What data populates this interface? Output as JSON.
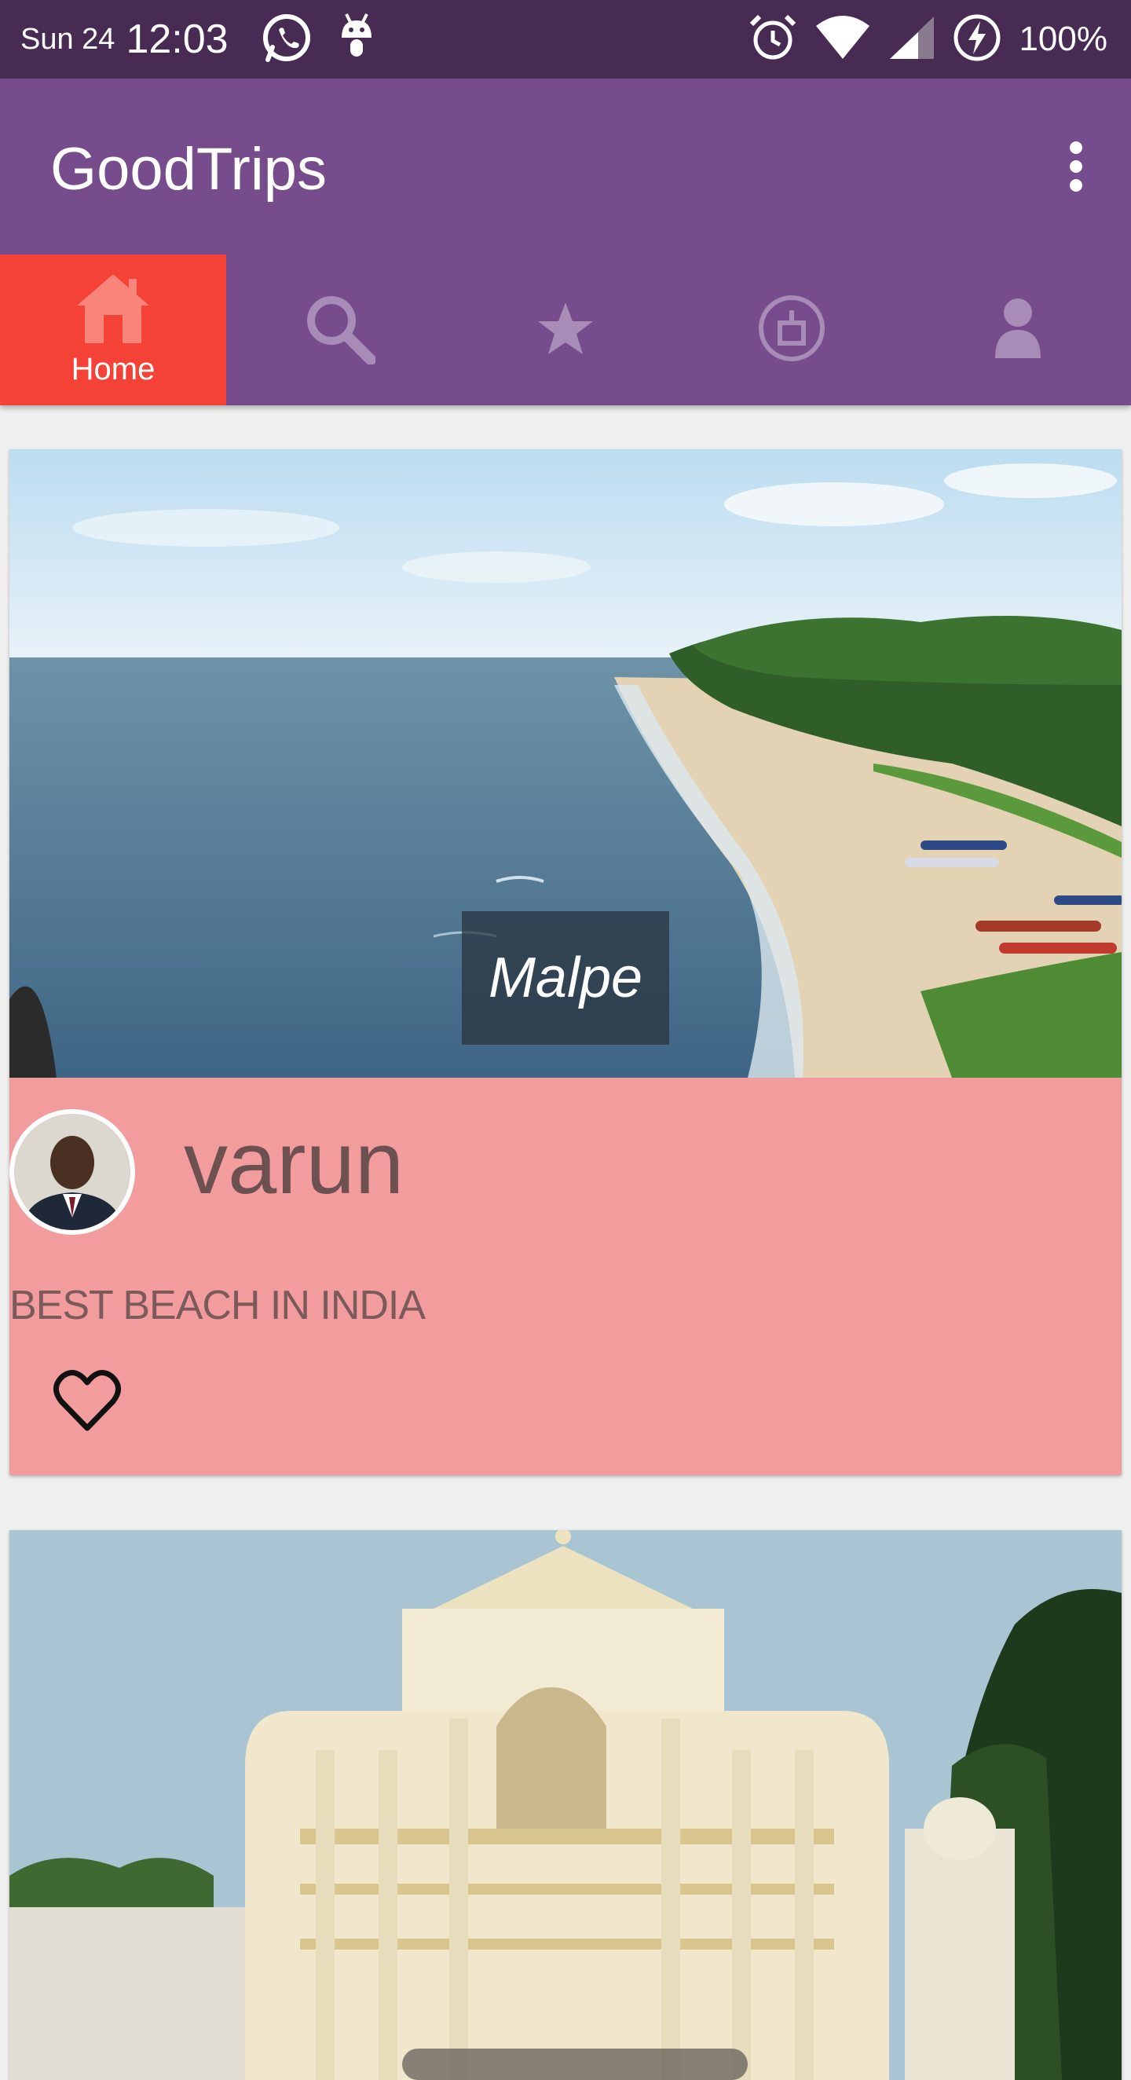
{
  "status_bar": {
    "date": "Sun 24",
    "time": "12:03",
    "battery": "100%",
    "icons": [
      "whatsapp-icon",
      "android-icon",
      "alarm-icon",
      "wifi-icon",
      "signal-icon",
      "battery-charging-icon"
    ]
  },
  "app_bar": {
    "title": "GoodTrips",
    "menu_icon": "overflow-menu-icon"
  },
  "tabs": [
    {
      "label": "Home",
      "icon": "home-icon",
      "active": true
    },
    {
      "label": "",
      "icon": "search-icon",
      "active": false
    },
    {
      "label": "",
      "icon": "star-icon",
      "active": false
    },
    {
      "label": "",
      "icon": "gift-icon",
      "active": false
    },
    {
      "label": "",
      "icon": "profile-icon",
      "active": false
    }
  ],
  "feed": [
    {
      "place": "Malpe",
      "author": "varun",
      "description": "BEST BEACH IN INDIA",
      "like_icon": "heart-outline-icon"
    },
    {
      "place": ""
    }
  ],
  "colors": {
    "status_bar": "#472b52",
    "primary": "#774c8c",
    "active_tab": "#f44236",
    "card_body": "#f29c9e"
  }
}
